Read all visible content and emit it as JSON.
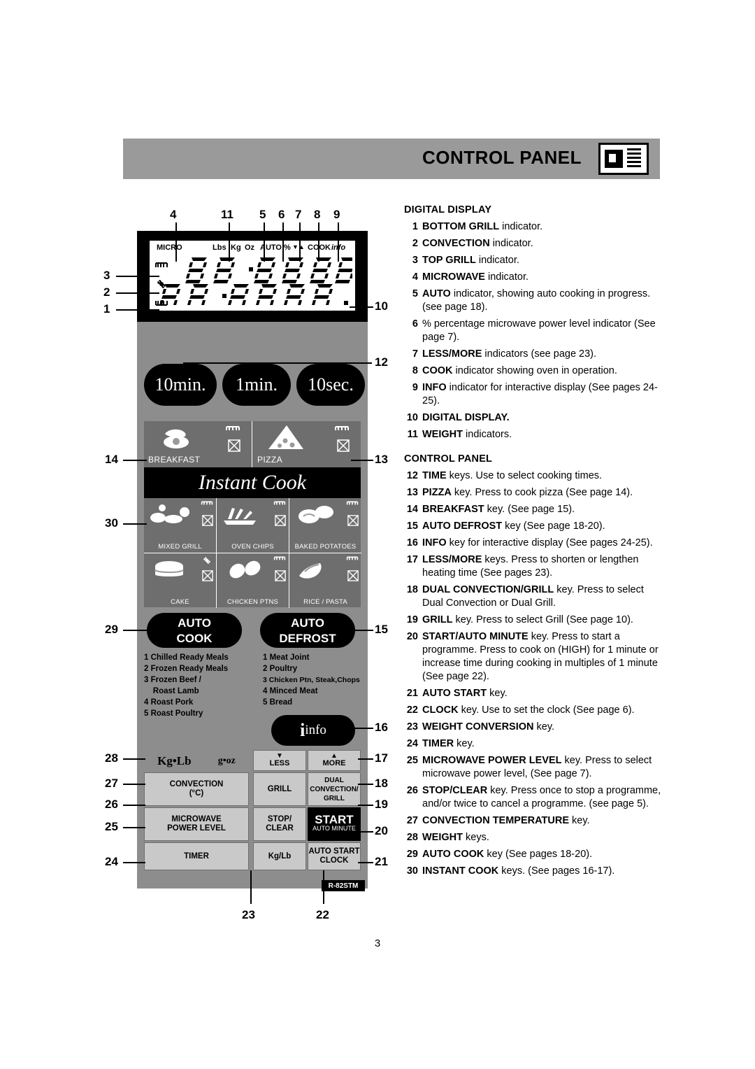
{
  "header": {
    "title": "CONTROL PANEL",
    "icon": "microwave-oven-icon"
  },
  "lcd": {
    "indicators_top": [
      "MICRO",
      "Lbs",
      "Kg",
      "Oz",
      "AUTO",
      "%",
      "▼▲",
      "COOK",
      "info"
    ],
    "left_icons": [
      "top-grill-icon",
      "convection-icon",
      "bottom-grill-icon"
    ]
  },
  "time_keys": [
    {
      "label": "10min."
    },
    {
      "label": "1min."
    },
    {
      "label": "10sec."
    }
  ],
  "instant_cook": {
    "banner": "Instant Cook",
    "top_cells": [
      {
        "label": "BREAKFAST",
        "icon": "egg-bacon-icon"
      },
      {
        "label": "PIZZA",
        "icon": "pizza-slice-icon"
      }
    ],
    "grid_cells": [
      {
        "label": "MIXED GRILL",
        "icon": "mixed-grill-icon"
      },
      {
        "label": "OVEN CHIPS",
        "icon": "oven-chips-icon"
      },
      {
        "label": "BAKED POTATOES",
        "icon": "baked-potatoes-icon"
      },
      {
        "label": "CAKE",
        "icon": "cake-icon"
      },
      {
        "label": "CHICKEN PTNS",
        "icon": "chicken-portions-icon"
      },
      {
        "label": "RICE / PASTA",
        "icon": "rice-pasta-icon"
      }
    ]
  },
  "auto_keys": [
    {
      "line1": "AUTO",
      "line2": "COOK"
    },
    {
      "line1": "AUTO",
      "line2": "DEFROST"
    }
  ],
  "auto_cook_menu": [
    "1 Chilled Ready Meals",
    "2 Frozen Ready Meals",
    "3 Frozen Beef /",
    "    Roast Lamb",
    "4 Roast Pork",
    "5 Roast Poultry"
  ],
  "auto_defrost_menu": [
    "1 Meat Joint",
    "2 Poultry",
    "3 Chicken Ptn, Steak,Chops",
    "4 Minced Meat",
    "5 Bread"
  ],
  "info_key": {
    "label": "info"
  },
  "keypad": {
    "weight_keys": {
      "kg_lb": "Kg•Lb",
      "g_oz": "g•oz"
    },
    "less": "LESS",
    "more": "MORE",
    "convection": "CONVECTION\n(°C)",
    "convection_l1": "CONVECTION",
    "convection_l2": "(°C)",
    "grill": "GRILL",
    "dual": "DUAL\nCONVECTION/\nGRILL",
    "dual_l1": "DUAL",
    "dual_l2": "CONVECTION/",
    "dual_l3": "GRILL",
    "micro_power_l1": "MICROWAVE",
    "micro_power_l2": "POWER LEVEL",
    "stop_l1": "STOP/",
    "stop_l2": "CLEAR",
    "start": "START",
    "auto_minute": "AUTO MINUTE",
    "timer": "TIMER",
    "kg_lb_btn": "Kg/Lb",
    "auto_start": "AUTO START",
    "clock": "CLOCK",
    "model": "R-82STM"
  },
  "callouts": [
    "1",
    "2",
    "3",
    "4",
    "5",
    "6",
    "7",
    "8",
    "9",
    "10",
    "11",
    "12",
    "13",
    "14",
    "15",
    "16",
    "17",
    "18",
    "19",
    "20",
    "21",
    "22",
    "23",
    "24",
    "25",
    "26",
    "27",
    "28",
    "29",
    "30"
  ],
  "right": {
    "heading1": "DIGITAL DISPLAY",
    "heading2": "CONTROL PANEL",
    "items1": [
      {
        "n": "1",
        "b": "BOTTOM GRILL",
        "t": " indicator."
      },
      {
        "n": "2",
        "b": "CONVECTION",
        "t": " indicator."
      },
      {
        "n": "3",
        "b": "TOP GRILL",
        "t": "  indicator."
      },
      {
        "n": "4",
        "b": "MICROWAVE",
        "t": " indicator."
      },
      {
        "n": "5",
        "b": "AUTO",
        "t": " indicator, showing auto cooking in progress. (see page 18)."
      },
      {
        "n": "6",
        "b": "",
        "t": "% percentage microwave power level indicator (See page 7)."
      },
      {
        "n": "7",
        "b": "LESS/MORE",
        "t": " indicators (see page 23)."
      },
      {
        "n": "8",
        "b": "COOK",
        "t": " indicator showing oven in operation."
      },
      {
        "n": "9",
        "b": "INFO",
        "t": " indicator for interactive display (See pages 24-25)."
      },
      {
        "n": "10",
        "b": "DIGITAL DISPLAY.",
        "t": ""
      },
      {
        "n": "11",
        "b": "WEIGHT",
        "t": " indicators."
      }
    ],
    "items2": [
      {
        "n": "12",
        "b": "TIME",
        "t": "  keys. Use to select cooking times."
      },
      {
        "n": "13",
        "b": "PIZZA",
        "t": " key. Press to cook pizza (See page 14)."
      },
      {
        "n": "14",
        "b": "BREAKFAST",
        "t": " key. (See page 15)."
      },
      {
        "n": "15",
        "b": "AUTO DEFROST",
        "t": " key (See page 18-20)."
      },
      {
        "n": "16",
        "b": "INFO",
        "t": " key for interactive display (See pages 24-25)."
      },
      {
        "n": "17",
        "b": "LESS/MORE",
        "t": " keys. Press to shorten or lengthen heating time (See pages 23)."
      },
      {
        "n": "18",
        "b": "DUAL CONVECTION/GRILL",
        "t": " key. Press to select Dual Convection or Dual Grill."
      },
      {
        "n": "19",
        "b": "GRILL",
        "t": " key. Press to select Grill (See page 10)."
      },
      {
        "n": "20",
        "b": "START/AUTO MINUTE",
        "t": " key. Press to start a programme. Press to cook on (HIGH) for 1 minute or increase time during cooking in multiples of 1 minute (See page 22)."
      },
      {
        "n": "21",
        "b": "AUTO START",
        "t": " key."
      },
      {
        "n": "22",
        "b": "CLOCK",
        "t": " key. Use to set the clock (See page 6)."
      },
      {
        "n": "23",
        "b": "WEIGHT CONVERSION",
        "t": " key."
      },
      {
        "n": "24",
        "b": "TIMER",
        "t": " key."
      },
      {
        "n": "25",
        "b": "MICROWAVE POWER LEVEL",
        "t": " key. Press to select microwave power level, (See page 7)."
      },
      {
        "n": "26",
        "b": "STOP/CLEAR",
        "t": " key. Press once to stop a programme, and/or twice to cancel a programme. (see page 5)."
      },
      {
        "n": "27",
        "b": "CONVECTION TEMPERATURE",
        "t": " key."
      },
      {
        "n": "28",
        "b": "WEIGHT",
        "t": " keys."
      },
      {
        "n": "29",
        "b": "AUTO COOK",
        "t": " key (See pages 18-20)."
      },
      {
        "n": "30",
        "b": "INSTANT COOK",
        "t": " keys. (See pages 16-17)."
      }
    ]
  },
  "page_number": "3"
}
